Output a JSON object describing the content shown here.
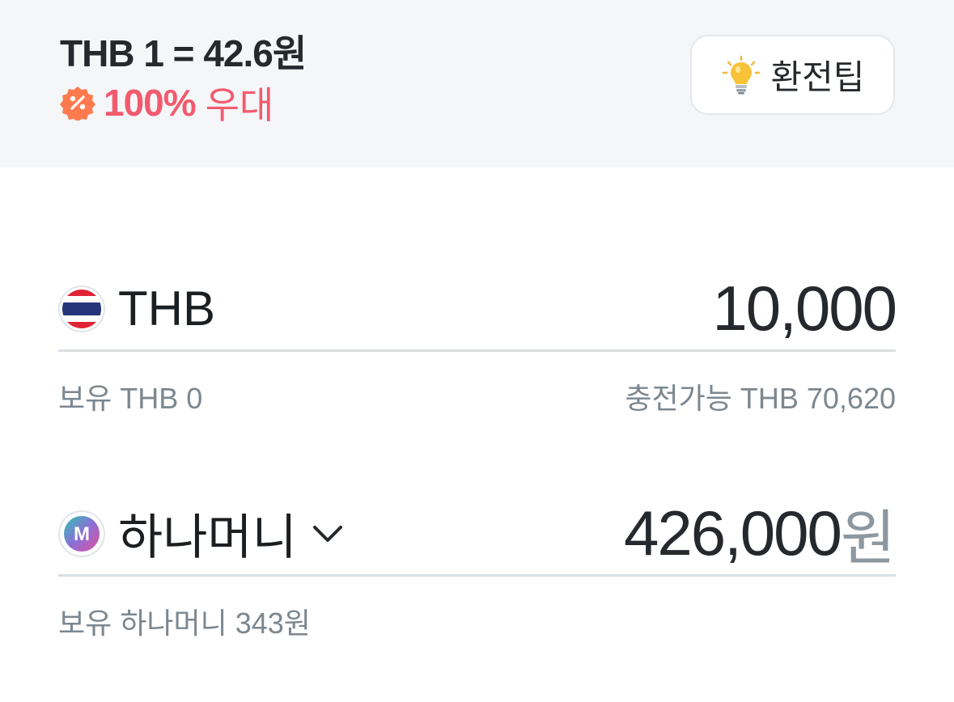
{
  "header": {
    "rate": "THB 1 = 42.6원",
    "discount_percent": "100%",
    "discount_label": "우대",
    "tip_label": "환전팁"
  },
  "from": {
    "currency": "THB",
    "amount": "10,000",
    "balance": "보유 THB 0",
    "chargeable": "충전가능 THB 70,620"
  },
  "to": {
    "currency": "하나머니",
    "amount": "426,000",
    "unit": "원",
    "balance": "보유 하나머니 343원"
  },
  "colors": {
    "accent": "#f25a6e",
    "discount_icon": "#ff7b4f",
    "text": "#25292d",
    "muted": "#7c878f"
  },
  "icons": {
    "discount": "percent-badge-icon",
    "tip": "lightbulb-icon",
    "from_currency": "thailand-flag-icon",
    "to_currency": "hana-money-icon",
    "dropdown": "chevron-down-icon"
  }
}
